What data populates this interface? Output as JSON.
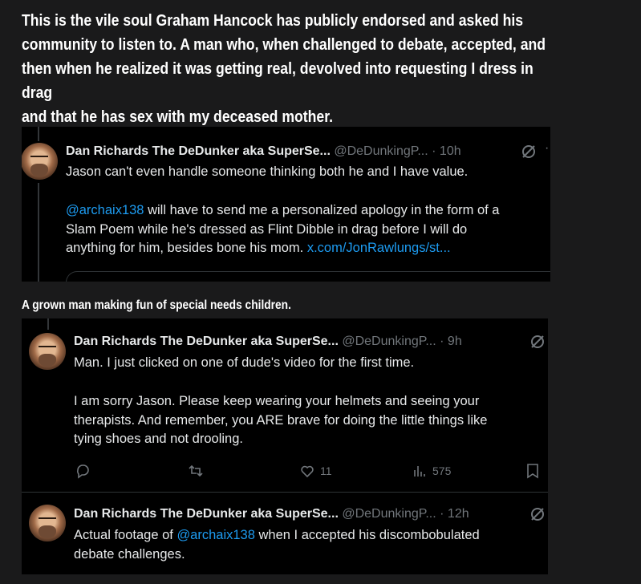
{
  "post": {
    "intro_text": "This is the vile soul Graham Hancock has publicly endorsed and asked his\ncommunity to listen to.  A man who, when challenged to debate, accepted, and\nthen when he realized it was getting real, devolved into requesting I dress in drag\nand that he has sex with my deceased mother.",
    "caption": "A grown man making fun of special needs children."
  },
  "tweet1": {
    "display_name": "Dan Richards The DeDunker aka SuperSe...",
    "handle": "@DeDunkingP...",
    "time": "· 10h",
    "icon": "grok-icon",
    "line1": "Jason can't even handle someone thinking both he and I have value.",
    "mention": "@archaix138",
    "text_a": " will have to send me a personalized apology in the form of a\nSlam Poem while he's dressed as Flint Dibble in drag before I will do\nanything for him, besides bone his mom. ",
    "link": "x.com/JonRawlungs/st..."
  },
  "tweet2": {
    "display_name": "Dan Richards The DeDunker aka SuperSe...",
    "handle": "@DeDunkingP...",
    "time": "· 9h",
    "line1": "Man. I just clicked on one of dude's video for the first time.",
    "text_b": "I am sorry Jason. Please keep wearing your helmets and seeing your\ntherapists. And remember, you ARE brave for doing the little things like\ntying shoes and not drooling.",
    "likes": "11",
    "views": "575"
  },
  "tweet3": {
    "display_name": "Dan Richards The DeDunker aka SuperSe...",
    "handle": "@DeDunkingP...",
    "time": "· 12h",
    "text_prefix": "Actual footage of ",
    "mention": "@archaix138",
    "text_suffix": " when I accepted his discombobulated\ndebate challenges."
  },
  "colors": {
    "page_bg": "#1a1a1b",
    "tweet_bg": "#000000",
    "text": "#e7e9ea",
    "muted": "#71767b",
    "link": "#1d9bf0"
  }
}
